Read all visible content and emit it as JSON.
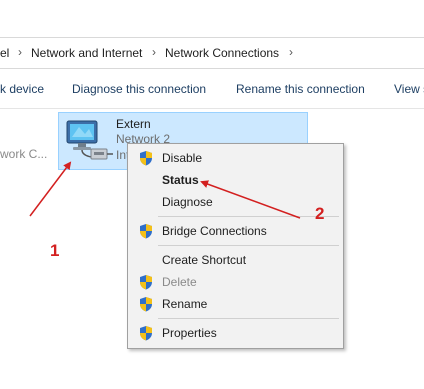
{
  "breadcrumb": {
    "items": [
      "el",
      "Network and Internet",
      "Network Connections"
    ],
    "separator": "›"
  },
  "command_bar": {
    "items": [
      "k device",
      "Diagnose this connection",
      "Rename this connection",
      "View s"
    ]
  },
  "content": {
    "left_partial_label": "work C..."
  },
  "adapter": {
    "name": "Extern",
    "network": "Network 2",
    "description": "Int"
  },
  "context_menu": {
    "items": [
      {
        "label": "Disable",
        "icon": "shield-icon",
        "bold": false,
        "disabled": false
      },
      {
        "label": "Status",
        "icon": null,
        "bold": true,
        "disabled": false
      },
      {
        "label": "Diagnose",
        "icon": null,
        "bold": false,
        "disabled": false
      },
      {
        "label": "Bridge Connections",
        "icon": "shield-icon",
        "bold": false,
        "disabled": false
      },
      {
        "label": "Create Shortcut",
        "icon": null,
        "bold": false,
        "disabled": false
      },
      {
        "label": "Delete",
        "icon": "shield-icon",
        "bold": false,
        "disabled": true
      },
      {
        "label": "Rename",
        "icon": "shield-icon",
        "bold": false,
        "disabled": false
      },
      {
        "label": "Properties",
        "icon": "shield-icon",
        "bold": false,
        "disabled": false
      }
    ]
  },
  "annotations": {
    "numbers": [
      "1",
      "2"
    ],
    "color": "#d32020"
  },
  "colors": {
    "selection_bg": "#cce8ff",
    "selection_border": "#99d1ff",
    "menu_bg": "#f2f2f2",
    "command_text": "#1e3f63"
  }
}
